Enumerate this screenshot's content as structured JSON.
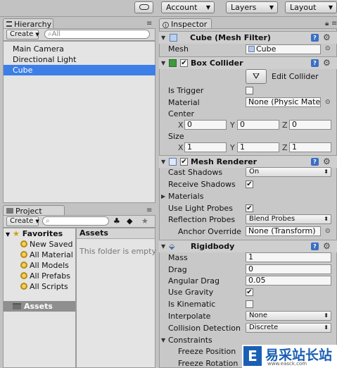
{
  "toolbar": {
    "cloud_icon": "cloud-icon",
    "account": "Account",
    "layers": "Layers",
    "layout": "Layout"
  },
  "hierarchy": {
    "tab": "Hierarchy",
    "create": "Create",
    "search_placeholder": "All",
    "items": [
      "Main Camera",
      "Directional Light",
      "Cube"
    ],
    "selected": "Cube",
    "selection_color": "#3d7fe6"
  },
  "project": {
    "tab": "Project",
    "create": "Create",
    "favorites": "Favorites",
    "favorite_items": [
      "New Saved",
      "All Material",
      "All Models",
      "All Prefabs",
      "All Scripts"
    ],
    "assets_folder": "Assets",
    "assets_header": "Assets",
    "empty_text": "This folder is empty"
  },
  "inspector": {
    "tab": "Inspector",
    "mesh_filter": {
      "title": "Cube (Mesh Filter)",
      "mesh_label": "Mesh",
      "mesh_value": "Cube"
    },
    "box_collider": {
      "title": "Box Collider",
      "enabled": true,
      "edit_collider": "Edit Collider",
      "is_trigger_label": "Is Trigger",
      "is_trigger": false,
      "material_label": "Material",
      "material_value": "None (Physic Mater",
      "center_label": "Center",
      "center": {
        "x": "0",
        "y": "0",
        "z": "0"
      },
      "size_label": "Size",
      "size": {
        "x": "1",
        "y": "1",
        "z": "1"
      },
      "axis_x": "X",
      "axis_y": "Y",
      "axis_z": "Z"
    },
    "mesh_renderer": {
      "title": "Mesh Renderer",
      "enabled": true,
      "cast_shadows_label": "Cast Shadows",
      "cast_shadows": "On",
      "receive_shadows_label": "Receive Shadows",
      "receive_shadows": true,
      "materials_label": "Materials",
      "light_probes_label": "Use Light Probes",
      "light_probes": true,
      "reflection_probes_label": "Reflection Probes",
      "reflection_probes": "Blend Probes",
      "anchor_override_label": "Anchor Override",
      "anchor_override": "None (Transform)"
    },
    "rigidbody": {
      "title": "Rigidbody",
      "mass_label": "Mass",
      "mass": "1",
      "drag_label": "Drag",
      "drag": "0",
      "angular_drag_label": "Angular Drag",
      "angular_drag": "0.05",
      "use_gravity_label": "Use Gravity",
      "use_gravity": true,
      "is_kinematic_label": "Is Kinematic",
      "is_kinematic": false,
      "interpolate_label": "Interpolate",
      "interpolate": "None",
      "collision_label": "Collision Detection",
      "collision": "Discrete",
      "constraints_label": "Constraints",
      "freeze_position_label": "Freeze Position",
      "freeze_rotation_label": "Freeze Rotation"
    }
  },
  "watermark": {
    "text": "易采站长站",
    "subtext": "www.easck.com"
  }
}
